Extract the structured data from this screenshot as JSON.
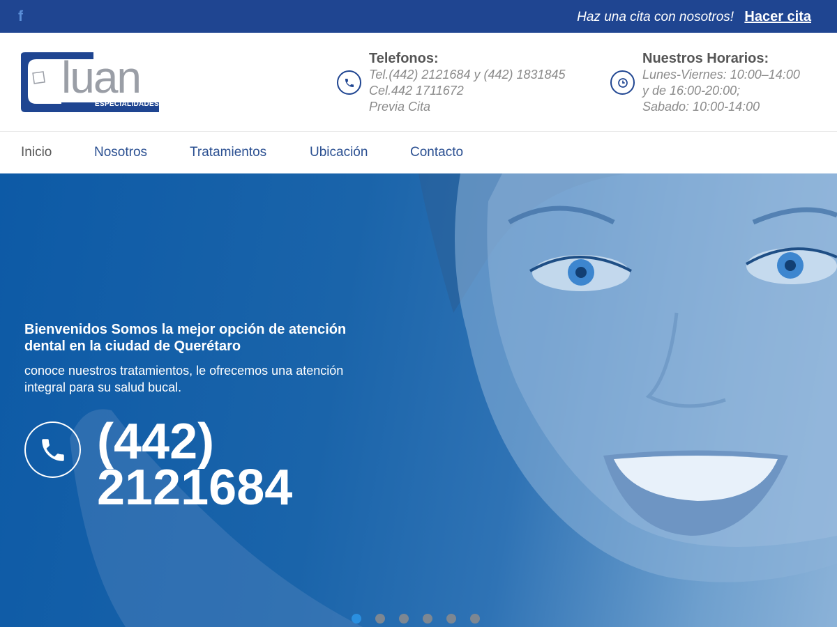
{
  "topbar": {
    "facebook_icon": "facebook-icon",
    "message": "Haz una cita con nosotros!",
    "cta_link": "Hacer cita"
  },
  "header": {
    "logo": {
      "main": "luan",
      "sub": "ESPECIALIDADES"
    },
    "phones": {
      "icon": "phone-icon",
      "title": "Telefonos:",
      "lines": [
        "Tel.(442) 2121684 y (442) 1831845",
        "Cel.442 1711672",
        "Previa Cita"
      ]
    },
    "hours": {
      "icon": "clock-icon",
      "title": "Nuestros Horarios:",
      "lines": [
        "Lunes-Viernes: 10:00–14:00",
        "y de 16:00-20:00;",
        "Sabado: 10:00-14:00"
      ]
    }
  },
  "nav": {
    "items": [
      {
        "label": "Inicio",
        "active": true
      },
      {
        "label": "Nosotros",
        "active": false
      },
      {
        "label": "Tratamientos",
        "active": false
      },
      {
        "label": "Ubicación",
        "active": false
      },
      {
        "label": "Contacto",
        "active": false
      }
    ]
  },
  "hero": {
    "title": "Bienvenidos Somos la mejor opción de atención dental en la ciudad de Querétaro",
    "subtitle": "conoce nuestros tratamientos, le ofrecemos una atención integral para su salud bucal.",
    "phone_icon": "phone-icon",
    "phone": "(442) 2121684",
    "slides_total": 6,
    "slide_active": 1
  },
  "colors": {
    "brand_blue": "#1f4591",
    "hero_blue": "#1a64aa",
    "dot_active": "#2a8fe0"
  }
}
